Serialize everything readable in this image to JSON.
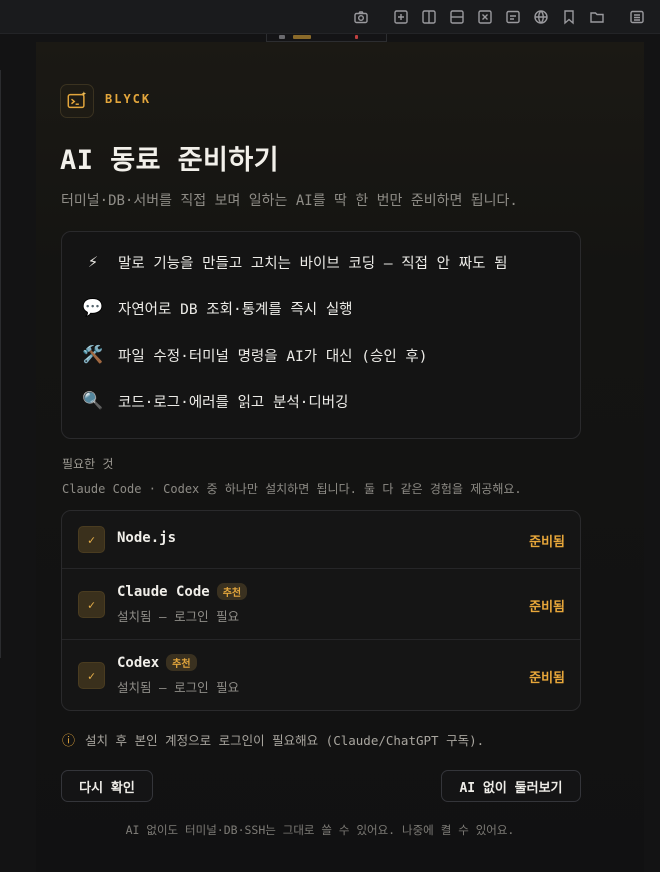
{
  "toolbar": {
    "icons": [
      "camera-icon",
      "new-tab-icon",
      "split-vertical-icon",
      "split-horizontal-icon",
      "close-pane-icon",
      "terminal-icon",
      "globe-icon",
      "bookmark-icon",
      "folder-icon",
      "menu-icon"
    ]
  },
  "brand": {
    "name": "BLYCK"
  },
  "header": {
    "title": "AI 동료 준비하기",
    "subtitle": "터미널·DB·서버를 직접 보며 일하는 AI를 딱 한 번만 준비하면 됩니다."
  },
  "features": [
    {
      "icon": "lightning-icon",
      "glyph": "⚡",
      "text": "말로 기능을 만들고 고치는 바이브 코딩 — 직접 안 짜도 됨"
    },
    {
      "icon": "speech-bubble-icon",
      "glyph": "💬",
      "text": "자연어로 DB 조회·통계를 즉시 실행"
    },
    {
      "icon": "tools-icon",
      "glyph": "🛠️",
      "text": "파일 수정·터미널 명령을 AI가 대신 (승인 후)"
    },
    {
      "icon": "magnifier-icon",
      "glyph": "🔍",
      "text": "코드·로그·에러를 읽고 분석·디버깅"
    }
  ],
  "requirements": {
    "title": "필요한 것",
    "description": "Claude Code · Codex 중 하나만 설치하면 됩니다. 둘 다 같은 경험을 제공해요.",
    "items": [
      {
        "name": "Node.js",
        "badge": "",
        "sub": "",
        "status": "준비됨"
      },
      {
        "name": "Claude Code",
        "badge": "추천",
        "sub": "설치됨 — 로그인 필요",
        "status": "준비됨"
      },
      {
        "name": "Codex",
        "badge": "추천",
        "sub": "설치됨 — 로그인 필요",
        "status": "준비됨"
      }
    ]
  },
  "notice": {
    "icon": "ⓘ",
    "text": "설치 후 본인 계정으로 로그인이 필요해요 (Claude/ChatGPT 구독)."
  },
  "buttons": {
    "recheck": "다시 확인",
    "skip": "AI 없이 둘러보기"
  },
  "footer": "AI 없이도 터미널·DB·SSH는 그대로 쓸 수 있어요. 나중에 켤 수 있어요.",
  "colors": {
    "accent": "#e3a63c",
    "background": "#131314",
    "panel": "#141414"
  }
}
